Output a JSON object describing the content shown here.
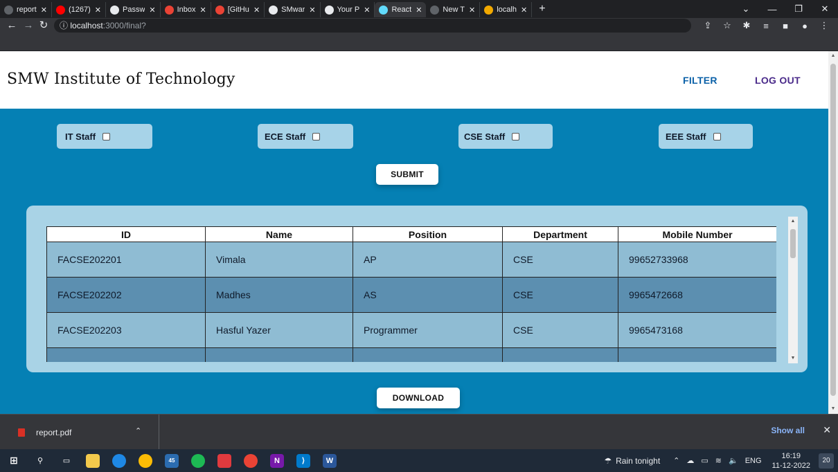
{
  "browser": {
    "tabs": [
      {
        "title": "report",
        "favicon": "chrome",
        "color": "#5f6368"
      },
      {
        "title": "(1267)",
        "favicon": "youtube",
        "color": "#ff0000"
      },
      {
        "title": "Passw",
        "favicon": "github",
        "color": "#e8eaed"
      },
      {
        "title": "Inbox",
        "favicon": "gmail",
        "color": "#ea4335"
      },
      {
        "title": "[GitHu",
        "favicon": "gmail",
        "color": "#ea4335"
      },
      {
        "title": "SMwar",
        "favicon": "github",
        "color": "#e8eaed"
      },
      {
        "title": "Your P",
        "favicon": "github",
        "color": "#e8eaed"
      },
      {
        "title": "React",
        "favicon": "react",
        "color": "#61dafb"
      },
      {
        "title": "New T",
        "favicon": "chrome",
        "color": "#5f6368"
      },
      {
        "title": "localh",
        "favicon": "localhost",
        "color": "#f2a900"
      }
    ],
    "active_tab": 7,
    "url_host": "localhost",
    "url_path": ":3000/final?"
  },
  "page": {
    "brand": "SMW Institute of Technology",
    "nav": {
      "filter": "FILTER",
      "logout": "LOG OUT"
    },
    "filters": [
      {
        "label": "IT Staff",
        "checked": false
      },
      {
        "label": "ECE Staff",
        "checked": false
      },
      {
        "label": "CSE Staff",
        "checked": false
      },
      {
        "label": "EEE Staff",
        "checked": false
      }
    ],
    "submit_label": "SUBMIT",
    "download_label": "DOWNLOAD",
    "table": {
      "headers": [
        "ID",
        "Name",
        "Position",
        "Department",
        "Mobile Number"
      ],
      "rows": [
        [
          "FACSE202201",
          "Vimala",
          "AP",
          "CSE",
          "99652733968"
        ],
        [
          "FACSE202202",
          "Madhes",
          "AS",
          "CSE",
          "9965472668"
        ],
        [
          "FACSE202203",
          "Hasful Yazer",
          "Programmer",
          "CSE",
          "9965473168"
        ],
        [
          "",
          "",
          "",
          "",
          ""
        ]
      ]
    }
  },
  "downloads": {
    "file": "report.pdf",
    "show_all": "Show all"
  },
  "taskbar": {
    "weather": "Rain tonight",
    "lang": "ENG",
    "time": "16:19",
    "date": "11-12-2022",
    "notifications": "20",
    "mail_badge": "45"
  }
}
